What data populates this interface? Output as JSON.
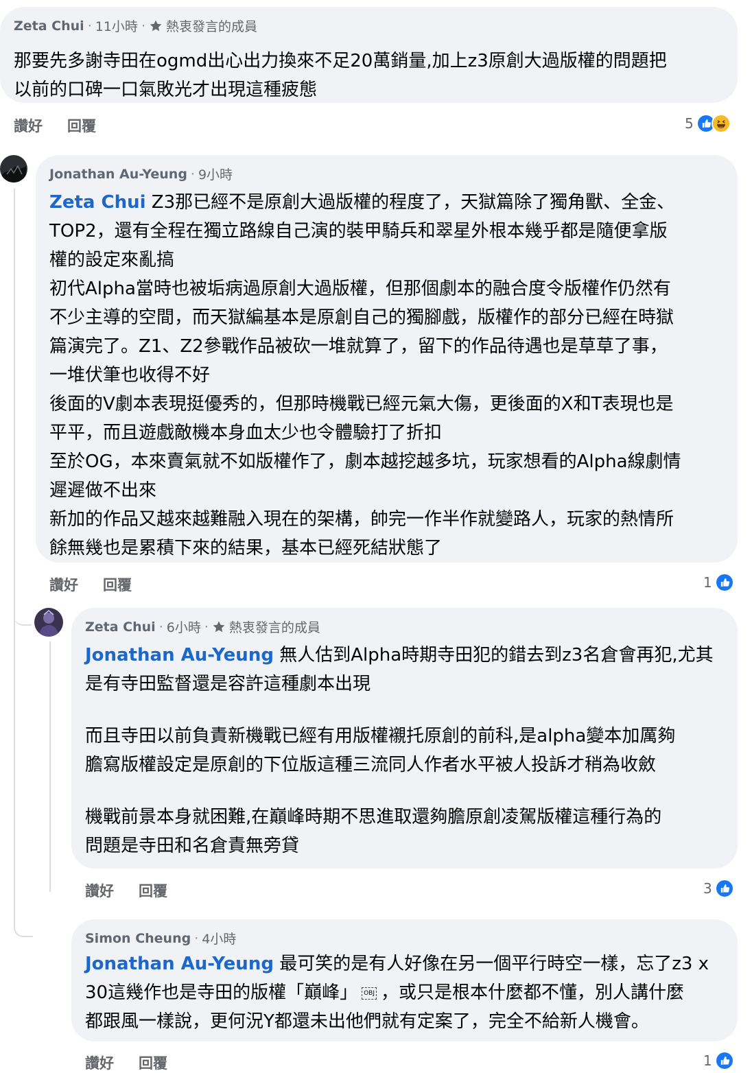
{
  "comments": [
    {
      "author": "Zeta Chui",
      "time": "11小時",
      "badge": "熱衷發言的成員",
      "mention": "",
      "lines": [
        "那要先多謝寺田在ogmd出心出力換來不足20萬銷量,加上z3原創大過版權的問題把",
        "以前的口碑一口氣敗光才出現這種疲態"
      ],
      "like_label": "讚好",
      "reply_label": "回覆",
      "reaction_count": "5",
      "reactions": [
        "like-icon",
        "haha-icon"
      ]
    },
    {
      "author": "Jonathan Au-Yeung",
      "time": "9小時",
      "badge": "",
      "mention": "Zeta Chui",
      "lines": [
        "Z3那已經不是原創大過版權的程度了，天獄篇除了獨角獸、全金、",
        "TOP2，還有全程在獨立路線自己演的裝甲騎兵和翠星外根本幾乎都是隨便拿版",
        "權的設定來亂搞",
        "初代Alpha當時也被垢病過原創大過版權，但那個劇本的融合度令版權作仍然有",
        "不少主導的空間，而天獄編基本是原創自己的獨腳戲，版權作的部分已經在時獄",
        "篇演完了。Z1、Z2參戰作品被砍一堆就算了，留下的作品待遇也是草草了事，",
        "一堆伏筆也收得不好",
        "後面的V劇本表現挺優秀的，但那時機戰已經元氣大傷，更後面的X和T表現也是",
        "平平，而且遊戲敵機本身血太少也令體驗打了折扣",
        "至於OG，本來賣氣就不如版權作了，劇本越挖越多坑，玩家想看的Alpha線劇情",
        "遲遲做不出來",
        "新加的作品又越來越難融入現在的架構，帥完一作半作就變路人，玩家的熱情所",
        "餘無幾也是累積下來的結果，基本已經死結狀態了"
      ],
      "like_label": "讚好",
      "reply_label": "回覆",
      "reaction_count": "1",
      "reactions": [
        "like-icon"
      ]
    },
    {
      "author": "Zeta Chui",
      "time": "6小時",
      "badge": "熱衷發言的成員",
      "mention": "Jonathan Au-Yeung",
      "paragraphs": [
        [
          "無人估到Alpha時期寺田犯的錯去到z3名倉會再犯,尤其",
          "是有寺田監督還是容許這種劇本出現"
        ],
        [
          "而且寺田以前負責新機戰已經有用版權襯托原創的前科,是alpha變本加厲夠",
          "膽寫版權設定是原創的下位版這種三流同人作者水平被人投訴才稍為收斂"
        ],
        [
          "機戰前景本身就困難,在巔峰時期不思進取還夠膽原創凌駕版權這種行為的",
          "問題是寺田和名倉責無旁貸"
        ]
      ],
      "like_label": "讚好",
      "reply_label": "回覆",
      "reaction_count": "3",
      "reactions": [
        "like-icon"
      ]
    },
    {
      "author": "Simon Cheung",
      "time": "4小時",
      "badge": "",
      "mention": "Jonathan Au-Yeung",
      "line1": "最可笑的是有人好像在另一個平行時空一樣，忘了z3 x",
      "line2_before": "30這幾作也是寺田的版權「巔峰」",
      "obj_marker": "OBJ",
      "line2_after": "，或只是根本什麼都不懂，別人講什麼",
      "line3": "都跟風一樣說，更何況Y都還未出他們就有定案了，完全不給新人機會。",
      "like_label": "讚好",
      "reply_label": "回覆",
      "reaction_count": "1",
      "reactions": [
        "like-icon"
      ]
    }
  ],
  "colors": {
    "bubble": "#f0f2f5",
    "mention": "#1d67c9",
    "meta": "#65676b",
    "like": "#1877f2",
    "haha": "#f7b928"
  }
}
